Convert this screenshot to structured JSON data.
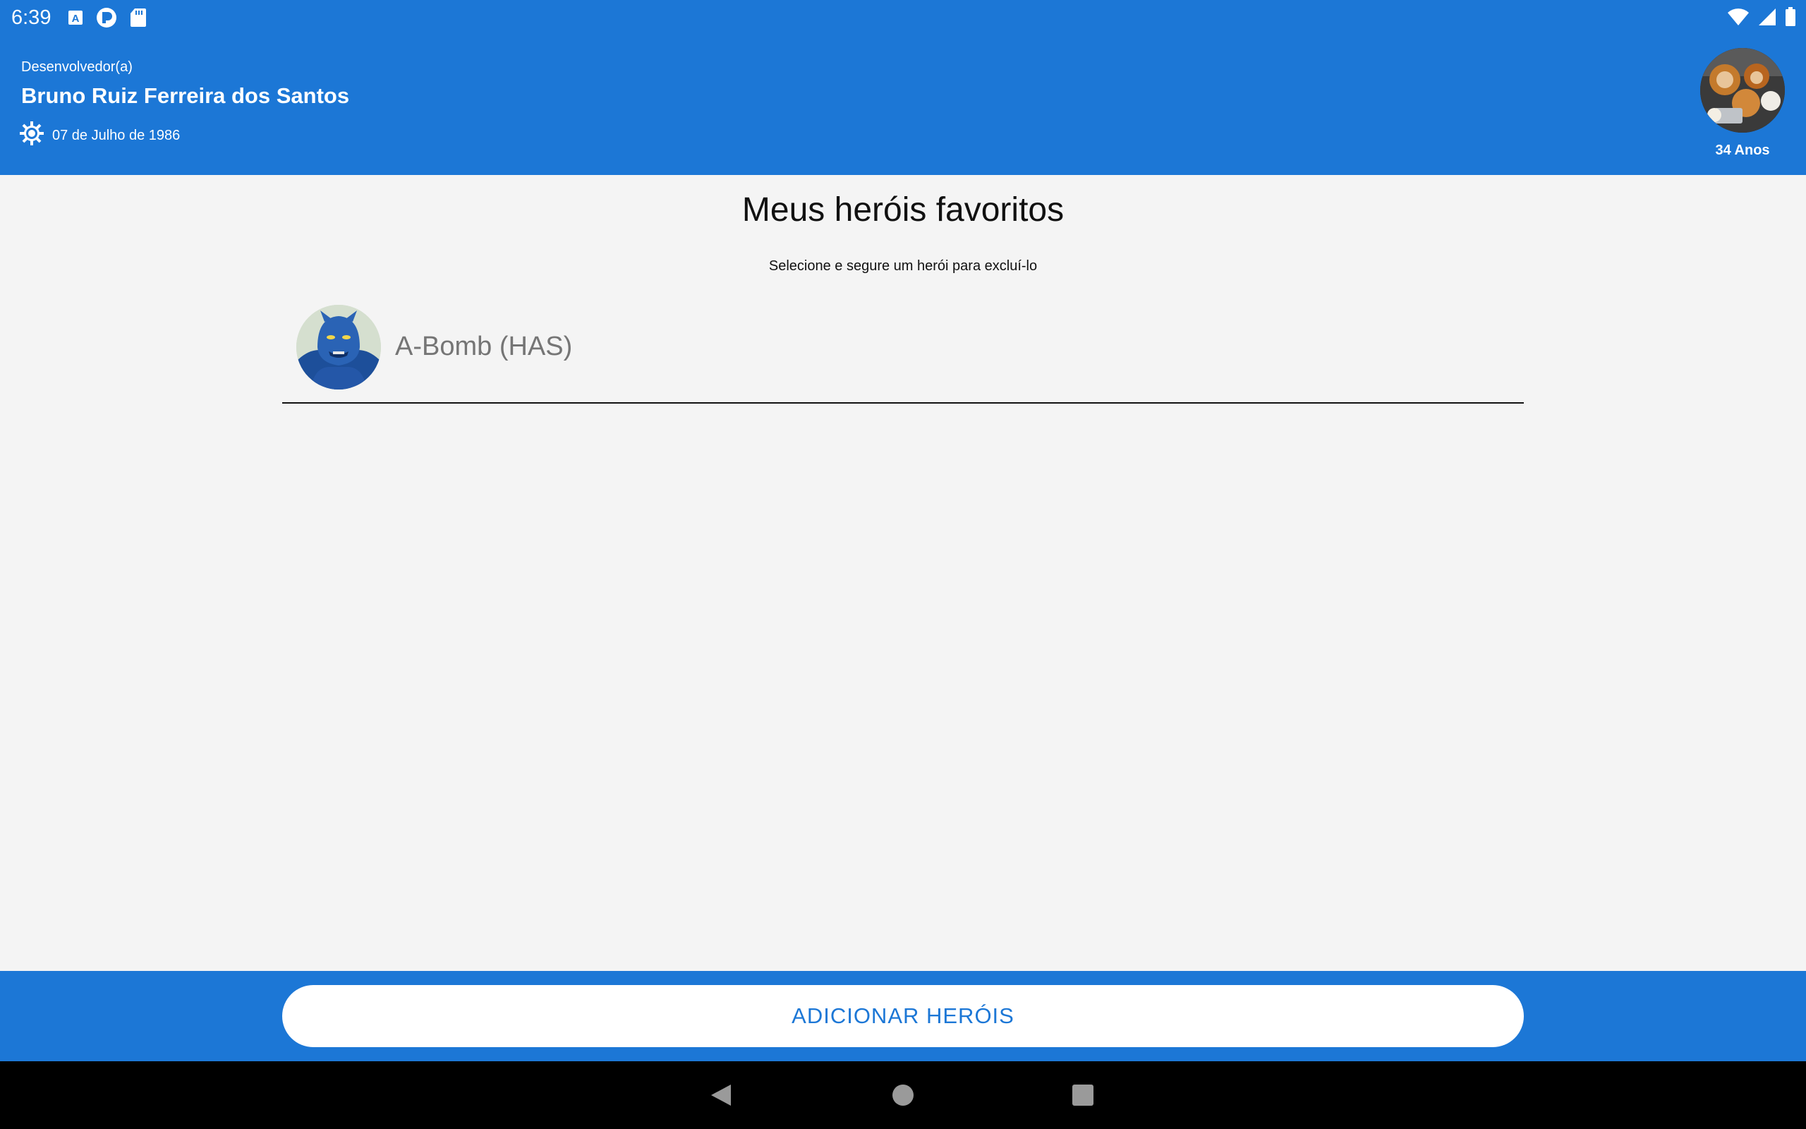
{
  "status_bar": {
    "time": "6:39",
    "left_icons": [
      "text-a-icon",
      "app-r-icon",
      "sd-card-icon"
    ],
    "right_icons": [
      "wifi-icon",
      "signal-icon",
      "battery-icon"
    ]
  },
  "header": {
    "role": "Desenvolvedor(a)",
    "name": "Bruno Ruiz Ferreira dos Santos",
    "birth_date": "07 de Julho de 1986",
    "birth_icon": "sun-icon",
    "age": "34 Anos",
    "background_color": "#1c77d6"
  },
  "main": {
    "title": "Meus heróis favoritos",
    "subtitle": "Selecione e segure um herói para excluí-lo",
    "heroes": [
      {
        "name": "A-Bomb (HAS)"
      }
    ]
  },
  "actions": {
    "add_heroes_label": "ADICIONAR HERÓIS"
  },
  "nav_bar": {
    "buttons": [
      "back-icon",
      "home-icon",
      "recents-icon"
    ]
  }
}
